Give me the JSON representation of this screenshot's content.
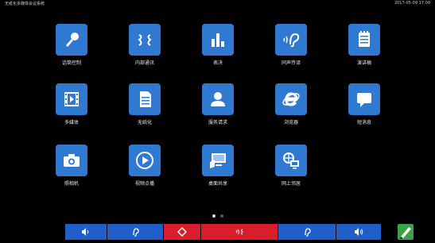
{
  "topbar": {
    "title": "无纸化多媒体会议系统",
    "time": "2017-05-09 17:00"
  },
  "apps": [
    {
      "label": "话筒控制",
      "icon": "microphone-icon"
    },
    {
      "label": "内部通讯",
      "icon": "intercom-icon"
    },
    {
      "label": "表决",
      "icon": "bar-chart-icon"
    },
    {
      "label": "同声传译",
      "icon": "ear-icon"
    },
    {
      "label": "演讲稿",
      "icon": "notepad-icon"
    },
    {
      "label": "多媒体",
      "icon": "film-icon"
    },
    {
      "label": "无纸化",
      "icon": "document-icon"
    },
    {
      "label": "服务请求",
      "icon": "person-icon"
    },
    {
      "label": "浏览器",
      "icon": "ie-browser-icon"
    },
    {
      "label": "短消息",
      "icon": "message-icon"
    },
    {
      "label": "照相机",
      "icon": "camera-icon"
    },
    {
      "label": "视频点播",
      "icon": "play-icon"
    },
    {
      "label": "桌面共享",
      "icon": "desktop-share-icon"
    },
    {
      "label": "网上邻居",
      "icon": "network-icon"
    }
  ],
  "pager": {
    "pages": 2,
    "current": 1
  },
  "bottombar": [
    {
      "icon": "volume-down-icon"
    },
    {
      "icon": "ear-listen-icon"
    },
    {
      "icon": "diamond-home-icon"
    },
    {
      "icon": "speak-icon"
    },
    {
      "icon": "ear-listen-icon"
    },
    {
      "icon": "volume-up-icon"
    }
  ],
  "colors": {
    "tile": "#2f79d0",
    "bar_blue": "#1f5fc7",
    "bar_red": "#d81e2a",
    "background": "#000000"
  }
}
